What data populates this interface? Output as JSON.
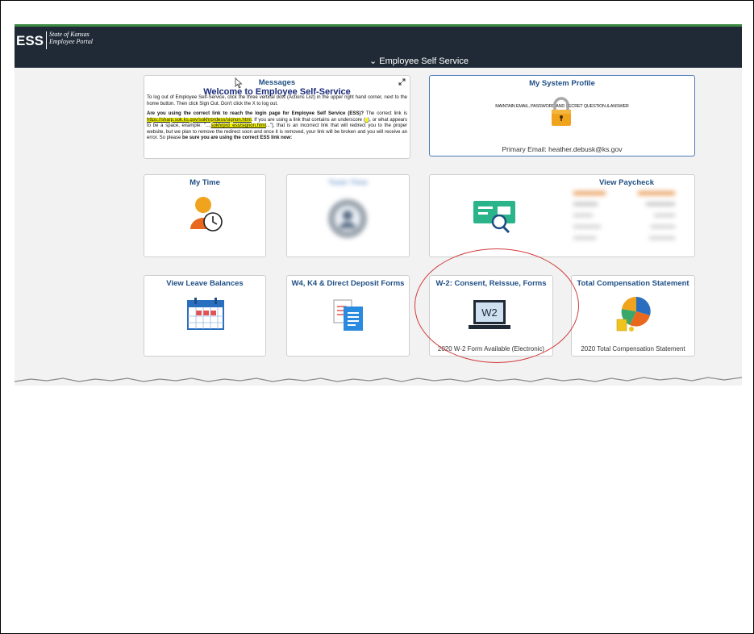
{
  "header": {
    "logo_text": "ESS",
    "logo_sub_line1": "State of Kansas",
    "logo_sub_line2": "Employee Portal",
    "nav_title": "⌄ Employee Self Service"
  },
  "messages_tile": {
    "title": "Messages",
    "welcome": "Welcome to Employee Self-Service",
    "para1": "To log out of Employee Self-Service, click the three vertical dots (Actions List) in the upper right hand corner, next to the home button. Then click Sign Out. Don't click the X to log out.",
    "para2_bold": "Are you using the correct link to reach the login page for Employee Self Service (ESS)?",
    "para2_a": " The correct link is ",
    "para2_link": "https://sharp.sok.ks.gov/sokhrprdess/signon.html",
    "para2_b": ". If you are using a link that contains an underscore (",
    "para2_us": "_",
    "para2_c": "), or what appears to be a space, example: \"....",
    "para2_bad": "sokhrprd_ess/signon.html",
    "para2_d": "...\"], that is an incorrect link that will redirect you to the proper website, but we plan to remove the redirect soon and once it is removed, your link will be broken and you will receive an error. So please ",
    "para2_be": "be sure you are using the correct ESS link now:"
  },
  "profile_tile": {
    "title": "My System Profile",
    "subtitle": "MAINTAIN EMAIL, PASSWORD AND SECRET QUESTION & ANSWER",
    "footer": "Primary Email: heather.debusk@ks.gov"
  },
  "tiles": {
    "my_time": "My Time",
    "team_time": "Team Time",
    "view_paycheck": "View Paycheck",
    "leave_balances": "View Leave Balances",
    "w4_forms": "W4, K4 & Direct Deposit Forms",
    "w2_forms": "W-2: Consent, Reissue, Forms",
    "w2_footer": "2020 W-2 Form Available (Electronic)",
    "w2_icon_text": "W2",
    "total_comp": "Total Compensation Statement",
    "total_comp_footer": "2020 Total Compensation Statement"
  },
  "colors": {
    "header_bg": "#1f2a36",
    "tile_title": "#1f4f85",
    "annotation_circle": "#d23b3b",
    "highlight": "#f2f200"
  }
}
